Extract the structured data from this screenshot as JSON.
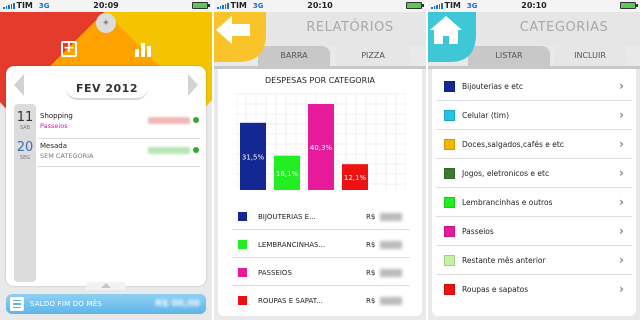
{
  "screens": [
    {
      "status": {
        "carrier": "TIM",
        "network": "3G",
        "time": "20:09"
      },
      "month": "FEV 2012",
      "entries": [
        {
          "day": "11",
          "weekday": "SAB",
          "title": "Shopping",
          "subtitle": "Passeios",
          "subtitle_color": "#c01fb6",
          "amount_color": "#f2b8b8",
          "date_color": "#333333"
        },
        {
          "day": "20",
          "weekday": "SEG",
          "title": "Mesada",
          "subtitle": "SEM CATEGORIA",
          "subtitle_color": "#777777",
          "amount_color": "#b8e6b8",
          "date_color": "#3a6ec0"
        }
      ],
      "balance": {
        "label": "SALDO FIM DO MÊS",
        "value": "R$ 00,00"
      },
      "icons": [
        "plus-icon",
        "bar-chart-icon",
        "gear-icon"
      ],
      "wheel_colors": [
        "#f5c400",
        "#ffa200",
        "#e53b2c"
      ]
    },
    {
      "status": {
        "carrier": "TIM",
        "network": "3G",
        "time": "20:10"
      },
      "title": "RELATÓRIOS",
      "tabs": [
        "BARRA",
        "PIZZA"
      ],
      "active_tab": 0,
      "legend": [
        {
          "label": "BIJOUTERIAS E...",
          "currency": "R$",
          "color": "#142893"
        },
        {
          "label": "LEMBRANCINHAS...",
          "currency": "R$",
          "color": "#22ee22"
        },
        {
          "label": "PASSEIOS",
          "currency": "R$",
          "color": "#e61b9b"
        },
        {
          "label": "ROUPAS E SAPAT...",
          "currency": "R$",
          "color": "#ee1111"
        }
      ]
    },
    {
      "status": {
        "carrier": "TIM",
        "network": "3G",
        "time": "20:10"
      },
      "title": "CATEGORIAS",
      "tabs": [
        "LISTAR",
        "INCLUIR"
      ],
      "active_tab": 0,
      "categories": [
        {
          "label": "Bijouterias e etc",
          "color": "#142893"
        },
        {
          "label": "Celular (tim)",
          "color": "#22c4e8"
        },
        {
          "label": "Doces,salgados,cafés e etc",
          "color": "#f5b400"
        },
        {
          "label": "Jogos, eletronicos e etc",
          "color": "#3b7a2e"
        },
        {
          "label": "Lembrancinhas e outros",
          "color": "#22ee22"
        },
        {
          "label": "Passeios",
          "color": "#e61b9b"
        },
        {
          "label": "Restante mês anterior",
          "color": "#c6f0a4"
        },
        {
          "label": "Roupas e sapatos",
          "color": "#ee1111"
        }
      ]
    }
  ],
  "chart_data": {
    "type": "bar",
    "title": "DESPESAS POR CATEGORIA",
    "categories": [
      "BIJOUTERIAS E...",
      "LEMBRANCINHAS...",
      "PASSEIOS",
      "ROUPAS E SAPAT..."
    ],
    "values": [
      31.5,
      16.1,
      40.3,
      12.1
    ],
    "value_labels": [
      "31,5%",
      "16,1%",
      "40,3%",
      "12,1%"
    ],
    "colors": [
      "#142893",
      "#22ee22",
      "#e61b9b",
      "#ee1111"
    ],
    "ylim": [
      0,
      45
    ],
    "grid": true,
    "legend": "below"
  }
}
